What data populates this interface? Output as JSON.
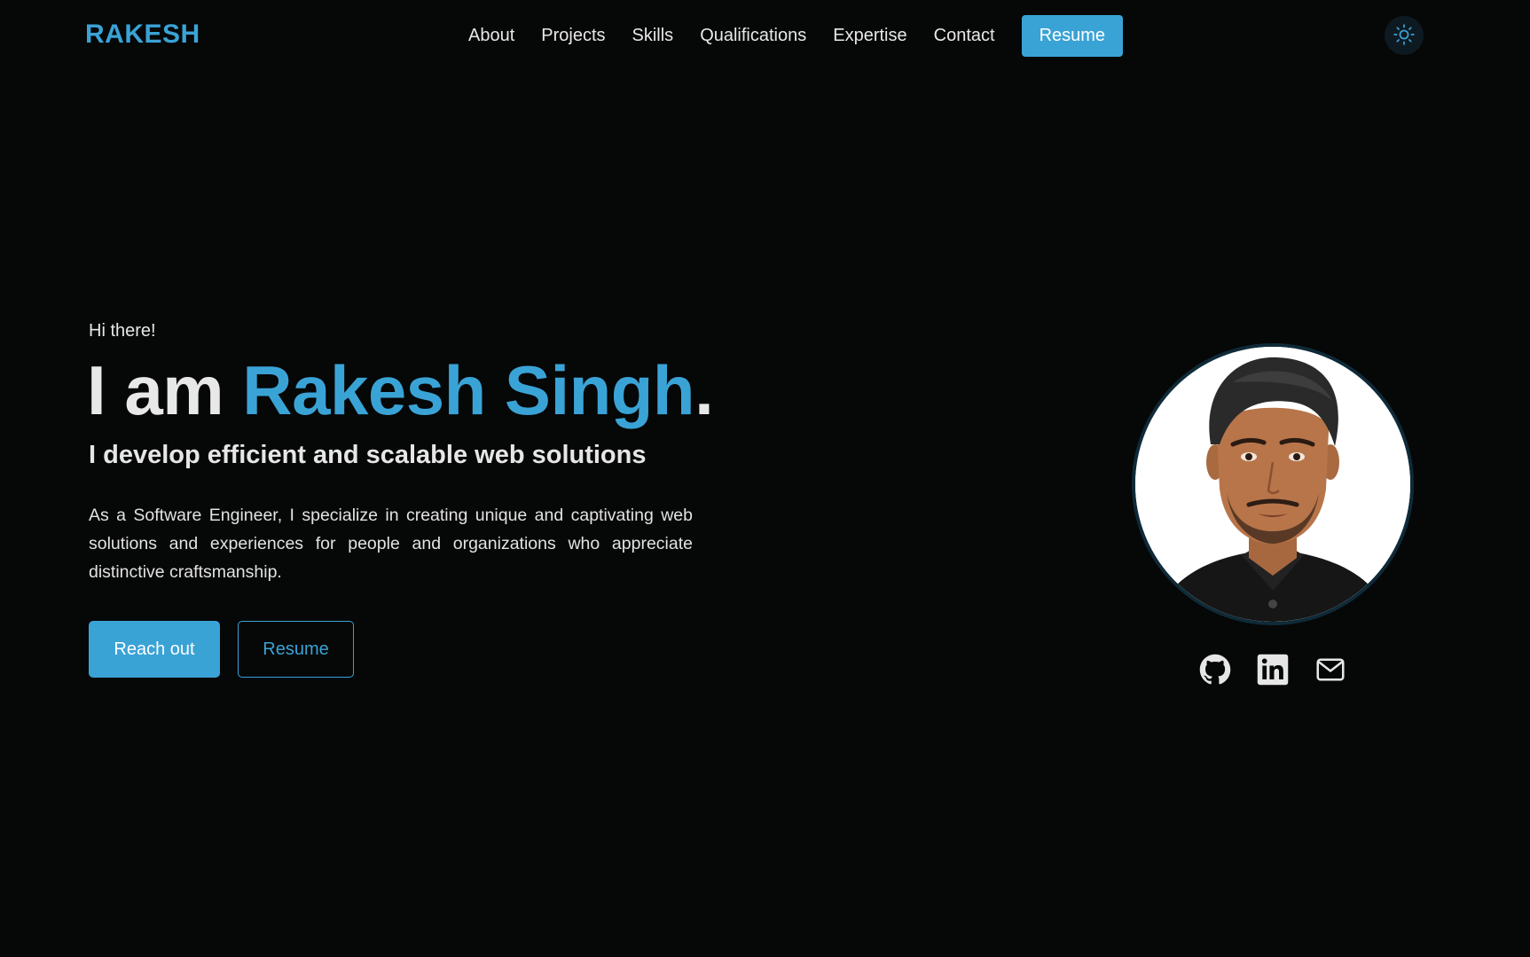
{
  "nav": {
    "logo": "RAKESH",
    "links": [
      "About",
      "Projects",
      "Skills",
      "Qualifications",
      "Expertise",
      "Contact"
    ],
    "resume_label": "Resume",
    "theme_icon": "sun-icon"
  },
  "hero": {
    "greeting": "Hi there!",
    "headline_prefix": "I am ",
    "headline_name": "Rakesh Singh",
    "headline_suffix": ".",
    "tagline": "I develop efficient and scalable web solutions",
    "description": "As a Software Engineer, I specialize in creating unique and captivating web solutions and experiences for people and organizations who appreciate distinctive craftsmanship.",
    "primary_button": "Reach out",
    "secondary_button": "Resume"
  },
  "social": {
    "icons": [
      "github-icon",
      "linkedin-icon",
      "mail-icon"
    ]
  },
  "colors": {
    "accent": "#3aa3d6",
    "background": "#060707",
    "text": "#e6e6e6"
  }
}
